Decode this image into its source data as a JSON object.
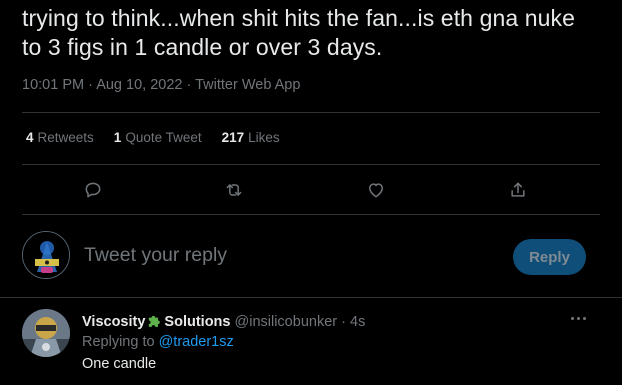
{
  "tweet": {
    "text_line1": "trying to think...when shit hits the fan...is eth gna nuke",
    "text_line2": "to 3 figs in 1 candle or over 3 days.",
    "time": "10:01 PM",
    "sep1": "·",
    "date": "Aug 10, 2022",
    "sep2": "·",
    "source": "Twitter Web App"
  },
  "stats": {
    "retweets_count": "4",
    "retweets_label": "Retweets",
    "quotes_count": "1",
    "quotes_label": "Quote Tweet",
    "likes_count": "217",
    "likes_label": "Likes"
  },
  "actions": {
    "icons": [
      "reply-icon",
      "retweet-icon",
      "like-icon",
      "share-icon"
    ],
    "color": "#71767b"
  },
  "compose": {
    "placeholder": "Tweet your reply",
    "button_label": "Reply",
    "button_color": "#0f4e78"
  },
  "reply": {
    "name_part1": "Viscosity",
    "name_part2": "Solutions",
    "emoji": "puzzle-piece-emoji",
    "handle": "@insilicobunker",
    "dot": "·",
    "time": "4s",
    "replying_prefix": "Replying to",
    "replying_to": "@trader1sz",
    "text": "One candle"
  },
  "colors": {
    "background": "#000000",
    "text": "#e7e9ea",
    "secondary": "#71767b",
    "accent": "#1d9bf0",
    "divider": "#2f3336"
  }
}
